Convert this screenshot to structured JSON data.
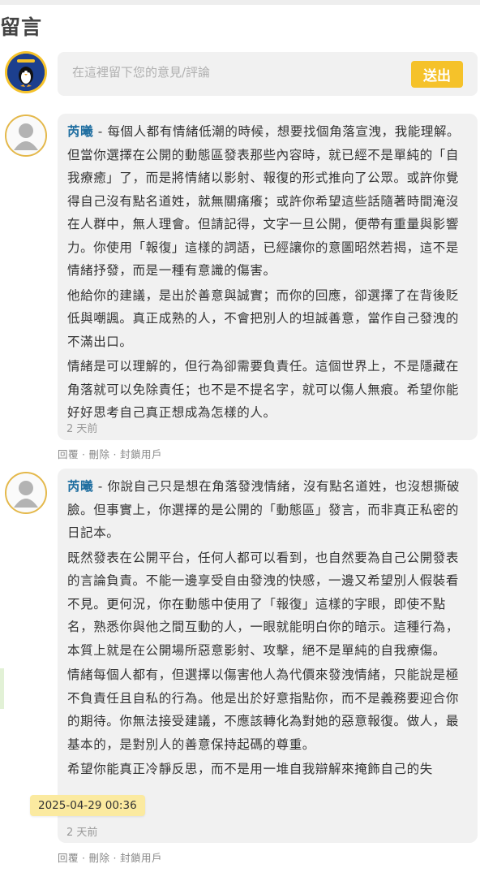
{
  "section": {
    "title": "留言"
  },
  "composer": {
    "placeholder": "在這裡留下您的意見/評論",
    "send_label": "送出",
    "avatar_label": "Dunpin Link"
  },
  "comments": [
    {
      "author": "芮曦",
      "separator": " - ",
      "paragraphs": [
        "每個人都有情緒低潮的時候，想要找個角落宣洩，我能理解。但當你選擇在公開的動態區發表那些內容時，就已經不是單純的「自我療癒」了，而是將情緒以影射、報復的形式推向了公眾。或許你覺得自己沒有點名道姓，就無關痛癢；或許你希望這些話隨著時間淹沒在人群中，無人理會。但請記得，文字一旦公開，便帶有重量與影響力。你使用「報復」這樣的詞語，已經讓你的意圖昭然若揭，這不是情緒抒發，而是一種有意識的傷害。",
        "他給你的建議，是出於善意與誠實；而你的回應，卻選擇了在背後貶低與嘲諷。真正成熟的人，不會把別人的坦誠善意，當作自己發洩的不滿出口。",
        "情緒是可以理解的，但行為卻需要負責任。這個世界上，不是隱藏在角落就可以免除責任；也不是不提名字，就可以傷人無痕。希望你能好好思考自己真正想成為怎樣的人。"
      ],
      "time": "2 天前",
      "actions": [
        "回覆",
        "刪除",
        "封鎖用戶"
      ]
    },
    {
      "author": "芮曦",
      "separator": " - ",
      "paragraphs": [
        "你說自己只是想在角落發洩情緒，沒有點名道姓，也沒想撕破臉。但事實上，你選擇的是公開的「動態區」發言，而非真正私密的日記本。",
        "既然發表在公開平台，任何人都可以看到，也自然要為自己公開發表的言論負責。不能一邊享受自由發洩的快感，一邊又希望別人假裝看不見。更何況，你在動態中使用了「報復」這樣的字眼，即使不點名，熟悉你與他之間互動的人，一眼就能明白你的暗示。這種行為，本質上就是在公開場所惡意影射、攻擊，絕不是單純的自我療傷。",
        "情緒每個人都有，但選擇以傷害他人為代價來發洩情緒，只能說是極不負責任且自私的行為。他是出於好意指點你，而不是義務要迎合你的期待。你無法接受建議，不應該轉化為對她的惡意報復。做人，最基本的，是對別人的善意保持起碼的尊重。",
        "希望你能真正冷靜反思，而不是用一堆自我辯解來掩飾自己的失"
      ],
      "time": "2 天前",
      "actions": [
        "回覆",
        "刪除",
        "封鎖用戶"
      ]
    }
  ],
  "tooltip": {
    "text": "2025-04-29 00:36"
  },
  "action_separator": "·",
  "colors": {
    "accent": "#f5c22a",
    "author": "#1f6ea0",
    "bubble": "#f1f1f1"
  }
}
